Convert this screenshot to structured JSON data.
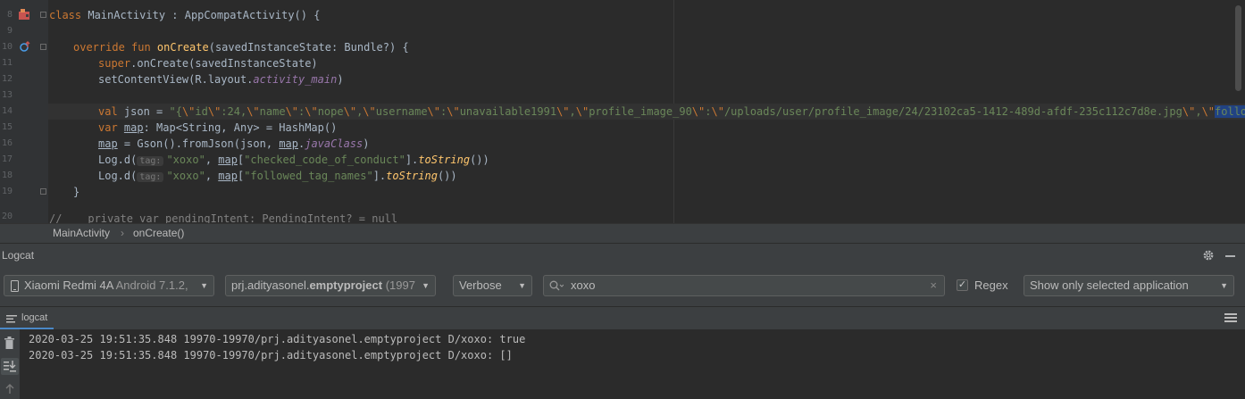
{
  "editor": {
    "line_numbers": [
      "8",
      "9",
      "10",
      "11",
      "12",
      "13",
      "14",
      "15",
      "16",
      "17",
      "18",
      "19",
      "20"
    ],
    "line8": {
      "kw": "class ",
      "name": "MainActivity : AppCompatActivity() {"
    },
    "line10": {
      "kw": "override fun ",
      "fn": "onCreate",
      "rest": "(savedInstanceState: Bundle?) {"
    },
    "line11": {
      "kw": "super",
      "rest": ".onCreate(savedInstanceState)"
    },
    "line12": {
      "pre": "setContentView(R.layout.",
      "prop": "activity_main",
      "post": ")"
    },
    "line14": {
      "kw": "val ",
      "pre": "json = ",
      "s1": "\"{",
      "e1": "\\\"",
      "s2": "id",
      "e2": "\\\"",
      "s3": ":24,",
      "e3": "\\\"",
      "s4": "name",
      "e4": "\\\"",
      "s5": ":",
      "e5": "\\\"",
      "s6": "nope",
      "e6": "\\\"",
      "s7": ",",
      "e7": "\\\"",
      "s8": "username",
      "e8": "\\\"",
      "s9": ":",
      "e9": "\\\"",
      "s10": "unavailable1991",
      "e10": "\\\"",
      "s11": ",",
      "e11": "\\\"",
      "s12": "profile_image_90",
      "e12": "\\\"",
      "s13": ":",
      "e13": "\\\"",
      "s14": "/uploads/user/profile_image/24/23102ca5-1412-489d-afdf-235c112c7d8e.jpg",
      "e14": "\\\"",
      "s15": ",",
      "e15": "\\\"",
      "sel": "followed_t"
    },
    "line15": {
      "kw": "var ",
      "var": "map",
      "rest": ": Map<String, Any> = HashMap()"
    },
    "line16": {
      "var": "map",
      "mid": " = Gson().fromJson(json, ",
      "var2": "map",
      "dot": ".",
      "prop": "javaClass",
      "post": ")"
    },
    "line17": {
      "pre": "Log.d(",
      "hint": "tag:",
      "str": "\"xoxo\"",
      "comma": ", ",
      "var": "map",
      "b1": "[",
      "str2": "\"checked_code_of_conduct\"",
      "b2": "].",
      "fn": "toString",
      "post": "())"
    },
    "line18": {
      "pre": "Log.d(",
      "hint": "tag:",
      "str": "\"xoxo\"",
      "comma": ", ",
      "var": "map",
      "b1": "[",
      "str2": "\"followed_tag_names\"",
      "b2": "].",
      "fn": "toString",
      "post": "())"
    },
    "line19": {
      "rest": "}"
    },
    "line20": {
      "rest": "//    private var pendingIntent: PendingIntent? = null"
    }
  },
  "breadcrumb": {
    "item1": "MainActivity",
    "sep": "›",
    "item2": "onCreate()"
  },
  "logcat": {
    "title": "Logcat",
    "device": {
      "name": "Xiaomi Redmi 4A",
      "version": " Android 7.1.2,"
    },
    "process": {
      "name": "prj.adityasonel.",
      "bold": "emptyproject",
      "pid": " (1997"
    },
    "level": "Verbose",
    "search_value": "xoxo",
    "regex_label": "Regex",
    "regex_checked": true,
    "filter": "Show only selected application",
    "tab_label": "logcat",
    "lines": [
      "2020-03-25 19:51:35.848 19970-19970/prj.adityasonel.emptyproject D/xoxo: true",
      "2020-03-25 19:51:35.848 19970-19970/prj.adityasonel.emptyproject D/xoxo: []"
    ]
  }
}
